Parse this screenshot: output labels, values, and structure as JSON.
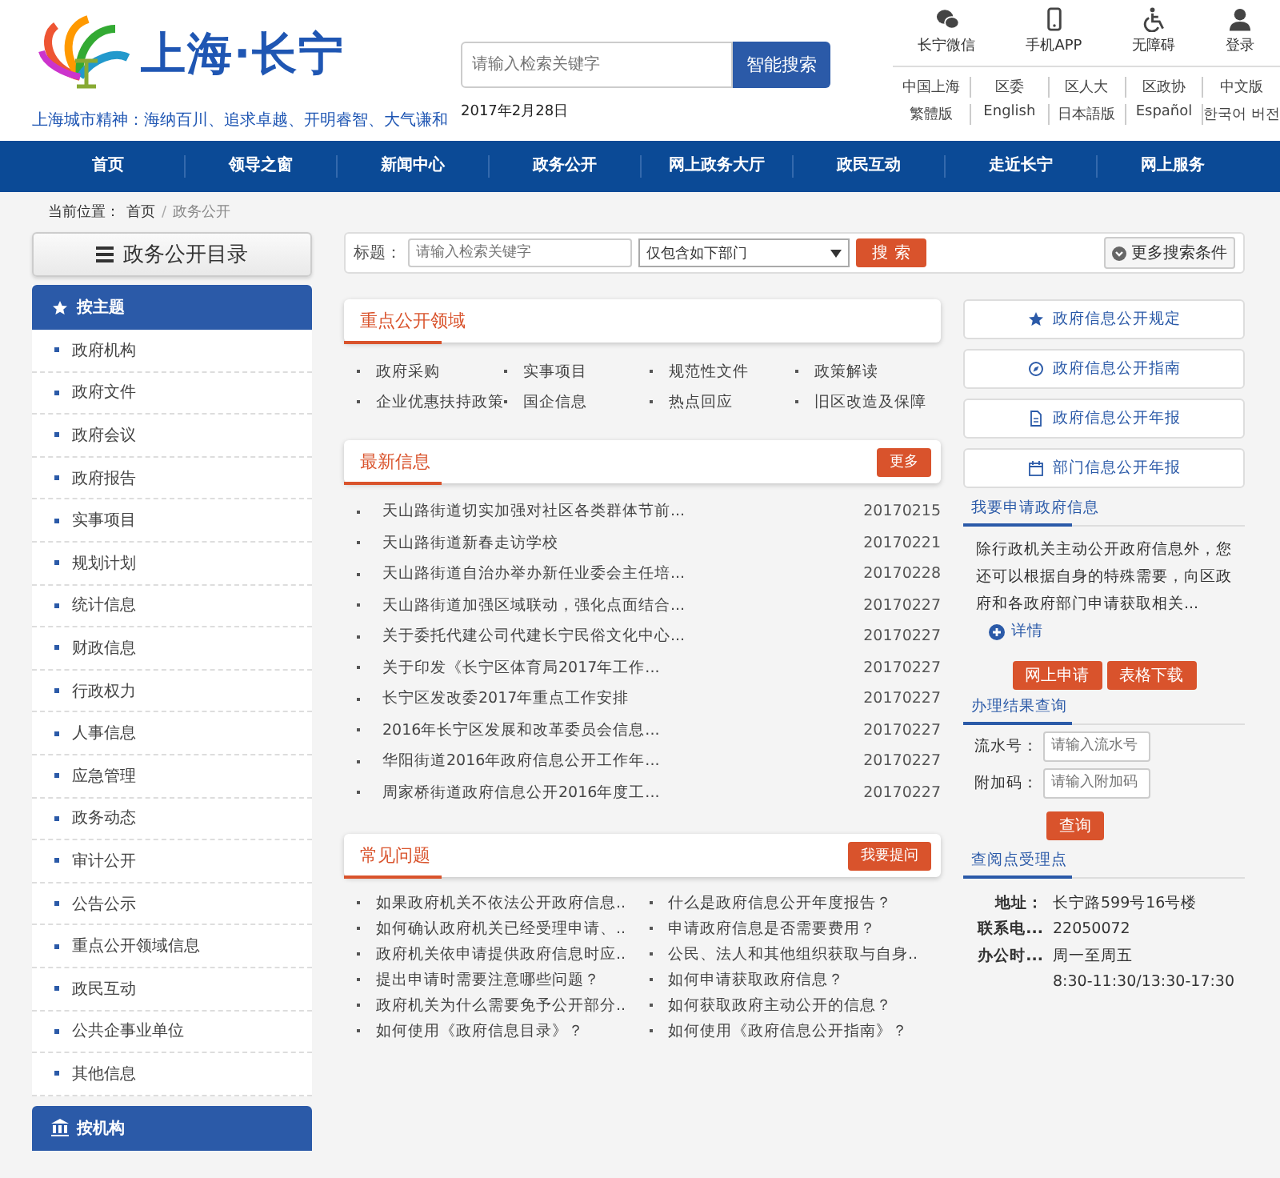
{
  "header": {
    "site_title": "上海·长宁",
    "slogan": "上海城市精神：海纳百川、追求卓越、开明睿智、大气谦和",
    "search": {
      "placeholder": "请输入检索关键字",
      "button": "智能搜索"
    },
    "date": "2017年2月28日",
    "quick_links": [
      {
        "label": "长宁微信",
        "kind": "wechat"
      },
      {
        "label": "手机APP",
        "kind": "phone"
      },
      {
        "label": "无障碍",
        "kind": "wheelchair"
      },
      {
        "label": "登录",
        "kind": "user"
      }
    ],
    "site_links": [
      [
        "中国上海",
        "区委",
        "区人大",
        "区政协",
        "中文版"
      ],
      [
        "繁體版",
        "English",
        "日本語版",
        "Español",
        "한국어 버전"
      ]
    ]
  },
  "nav": [
    "首页",
    "领导之窗",
    "新闻中心",
    "政务公开",
    "网上政务大厅",
    "政民互动",
    "走近长宁",
    "网上服务"
  ],
  "breadcrumb": {
    "label": "当前位置：",
    "separator": "/",
    "items": [
      "首页",
      "政务公开"
    ]
  },
  "catalog": {
    "title": "政务公开目录",
    "theme_header": "按主题",
    "items": [
      "政府机构",
      "政府文件",
      "政府会议",
      "政府报告",
      "实事项目",
      "规划计划",
      "统计信息",
      "财政信息",
      "行政权力",
      "人事信息",
      "应急管理",
      "政务动态",
      "审计公开",
      "公告公示",
      "重点公开领域信息",
      "政民互动",
      "公共企事业单位",
      "其他信息"
    ],
    "org_header": "按机构"
  },
  "filter": {
    "label": "标题：",
    "placeholder": "请输入检索关键字",
    "department": "仅包含如下部门",
    "search_button": "搜索",
    "more_button": "更多搜索条件"
  },
  "key_areas": {
    "title": "重点公开领域",
    "items": [
      "政府采购",
      "实事项目",
      "规范性文件",
      "政策解读",
      "企业优惠扶持政策",
      "国企信息",
      "热点回应",
      "旧区改造及保障"
    ]
  },
  "latest": {
    "title": "最新信息",
    "more_button": "更多",
    "rows": [
      {
        "title": "天山路街道切实加强对社区各类群体节前...",
        "date": "20170215"
      },
      {
        "title": "天山路街道新春走访学校",
        "date": "20170221"
      },
      {
        "title": "天山路街道自治办举办新任业委会主任培...",
        "date": "20170228"
      },
      {
        "title": "天山路街道加强区域联动，强化点面结合...",
        "date": "20170227"
      },
      {
        "title": "关于委托代建公司代建长宁民俗文化中心...",
        "date": "20170227"
      },
      {
        "title": "关于印发《长宁区体育局2017年工作...",
        "date": "20170227"
      },
      {
        "title": "长宁区发改委2017年重点工作安排",
        "date": "20170227"
      },
      {
        "title": "2016年长宁区发展和改革委员会信息...",
        "date": "20170227"
      },
      {
        "title": "华阳街道2016年政府信息公开工作年...",
        "date": "20170227"
      },
      {
        "title": "周家桥街道政府信息公开2016年度工...",
        "date": "20170227"
      }
    ]
  },
  "faq": {
    "title": "常见问题",
    "ask_button": "我要提问",
    "items": [
      "如果政府机关不依法公开政府信息..",
      "什么是政府信息公开年度报告？",
      "如何确认政府机关已经受理申请、..",
      "申请政府信息是否需要费用？",
      "政府机关依申请提供政府信息时应..",
      "公民、法人和其他组织获取与自身..",
      "提出申请时需要注意哪些问题？",
      "如何申请获取政府信息？",
      "政府机关为什么需要免予公开部分..",
      "如何获取政府主动公开的信息？",
      "如何使用《政府信息目录》？",
      "如何使用《政府信息公开指南》？"
    ]
  },
  "side_links": [
    {
      "label": "政府信息公开规定",
      "kind": "star"
    },
    {
      "label": "政府信息公开指南",
      "kind": "compass"
    },
    {
      "label": "政府信息公开年报",
      "kind": "document"
    },
    {
      "label": "部门信息公开年报",
      "kind": "calendar"
    }
  ],
  "apply": {
    "title": "我要申请政府信息",
    "text": "除行政机关主动公开政府信息外，您还可以根据自身的特殊需要，向区政府和各政府部门申请获取相关...",
    "detail": "详情",
    "buttons": [
      "网上申请",
      "表格下载"
    ]
  },
  "query": {
    "title": "办理结果查询",
    "fields": [
      {
        "label": "流水号：",
        "placeholder": "请输入流水号"
      },
      {
        "label": "附加码：",
        "placeholder": "请输入附加码"
      }
    ],
    "button": "查询"
  },
  "office": {
    "title": "查阅点受理点",
    "rows": [
      {
        "label": "地址：",
        "lines": [
          "长宁路599号16号楼"
        ]
      },
      {
        "label": "联系电...",
        "lines": [
          "22050072"
        ]
      },
      {
        "label": "办公时...",
        "lines": [
          "周一至周五",
          "8:30-11:30/13:30-17:30"
        ]
      }
    ]
  }
}
